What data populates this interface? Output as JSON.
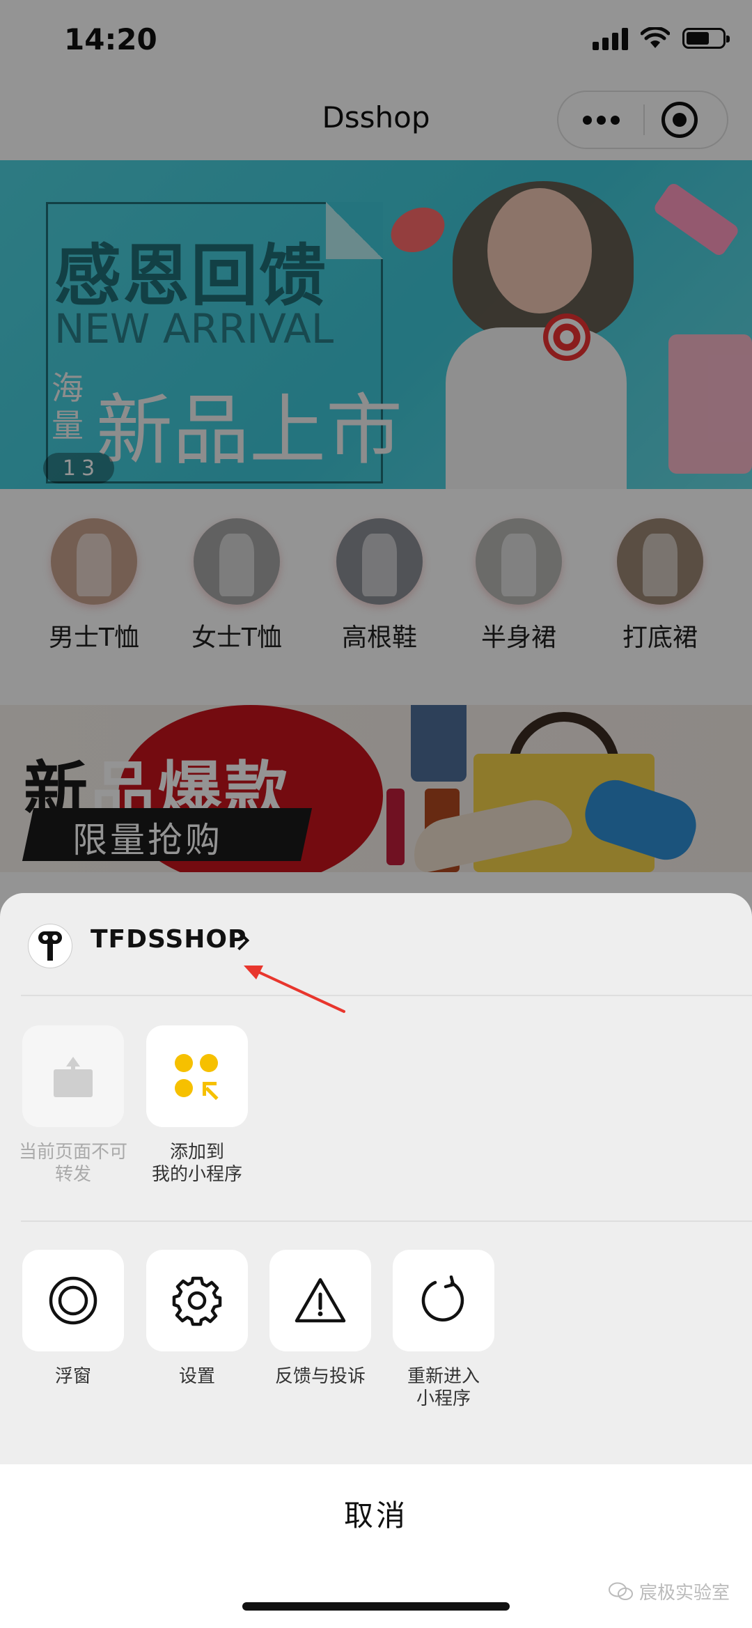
{
  "status_bar": {
    "time": "14:20"
  },
  "nav": {
    "title": "Dsshop"
  },
  "banner": {
    "headline": "感恩回馈",
    "subheadline": "NEW ARRIVAL",
    "side_text": "海量",
    "main_text": "新品上市",
    "indicator_current": "1",
    "indicator_total": "3"
  },
  "categories": [
    {
      "label": "男士T恤",
      "color": "#c9a38e"
    },
    {
      "label": "女士T恤",
      "color": "#a8a8a8"
    },
    {
      "label": "高根鞋",
      "color": "#8c8f96"
    },
    {
      "label": "半身裙",
      "color": "#b9b9b5"
    },
    {
      "label": "打底裙",
      "color": "#9b8774"
    }
  ],
  "promo": {
    "title_part1": "新",
    "title_part2": "品爆款",
    "subtitle": "限量抢购"
  },
  "sheet": {
    "app_name": "TFDSSHOP",
    "row1": [
      {
        "label": "当前页面不可转发",
        "icon": "share-icon",
        "disabled": true
      },
      {
        "label": "添加到我的小程序",
        "icon": "add-to-my-miniprogram-icon",
        "disabled": false
      }
    ],
    "row2": [
      {
        "label": "浮窗",
        "icon": "floating-window-icon"
      },
      {
        "label": "设置",
        "icon": "gear-icon"
      },
      {
        "label": "反馈与投诉",
        "icon": "warning-icon"
      },
      {
        "label": "重新进入小程序",
        "icon": "reload-icon"
      }
    ],
    "cancel": "取消"
  },
  "watermark": "宸极实验室",
  "colors": {
    "accent_yellow": "#f6c000",
    "banner_teal": "#3ec8d9",
    "promo_red": "#c8141c",
    "annotation_red": "#e8362d"
  }
}
